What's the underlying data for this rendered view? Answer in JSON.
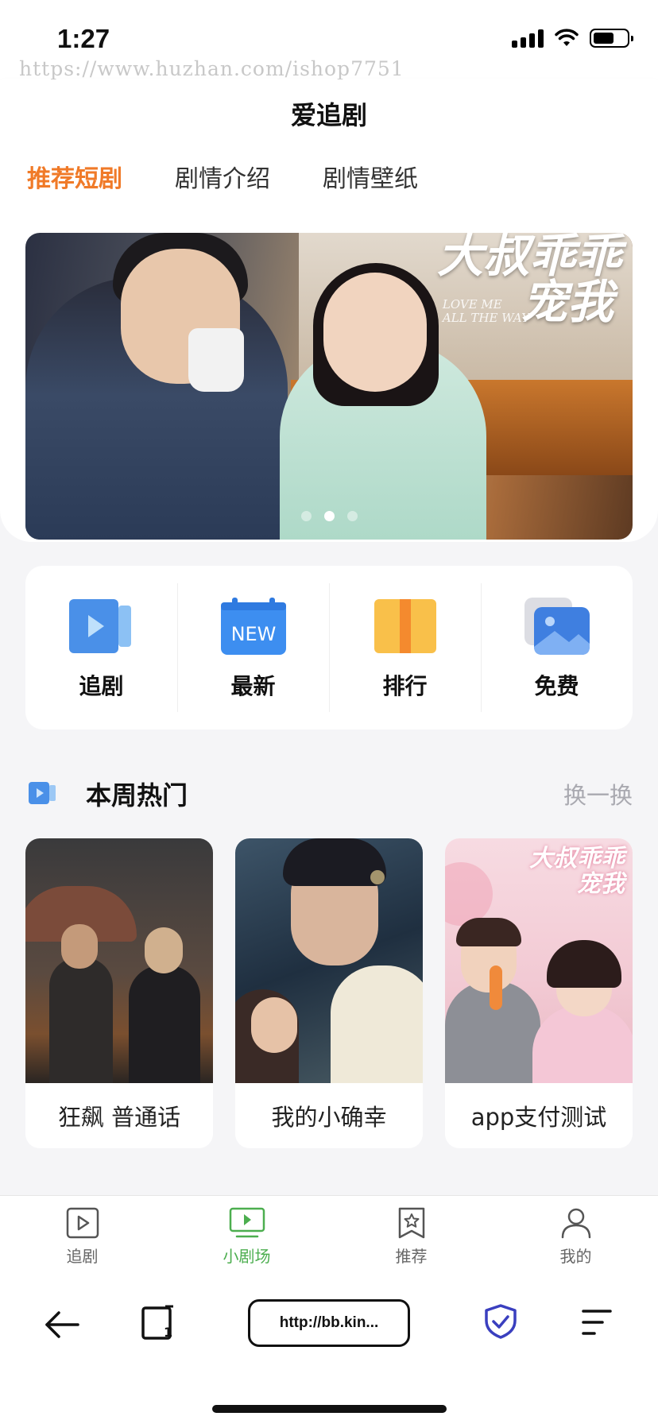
{
  "status_bar": {
    "time": "1:27",
    "watermark": "https://www.huzhan.com/ishop7751"
  },
  "header": {
    "title": "爱追剧",
    "tabs": [
      {
        "label": "推荐短剧",
        "active": true
      },
      {
        "label": "剧情介绍",
        "active": false
      },
      {
        "label": "剧情壁纸",
        "active": false
      }
    ]
  },
  "banner": {
    "title_line1": "大叔乖乖",
    "title_line2": "宠我",
    "subtitle_line1": "LOVE ME",
    "subtitle_line2": "ALL THE WAY",
    "slide_count": 3,
    "active_slide": 2
  },
  "quick_menu": [
    {
      "label": "追剧",
      "icon": "play-video-icon",
      "color": "#4a90e8"
    },
    {
      "label": "最新",
      "icon": "new-calendar-icon",
      "color": "#3d8ef0"
    },
    {
      "label": "排行",
      "icon": "ranking-icon",
      "color": "#f7b73a"
    },
    {
      "label": "免费",
      "icon": "image-icon",
      "color": "#3f7fe0"
    }
  ],
  "hot": {
    "title": "本周热门",
    "refresh_label": "换一换",
    "items": [
      {
        "title": "狂飙 普通话"
      },
      {
        "title": "我的小确幸"
      },
      {
        "title": "app支付测试",
        "poster_text_line1": "大叔乖乖",
        "poster_text_line2": "宠我"
      }
    ]
  },
  "tabbar": [
    {
      "label": "追剧",
      "icon": "play-square-icon",
      "active": false
    },
    {
      "label": "小剧场",
      "icon": "tv-icon",
      "active": true
    },
    {
      "label": "推荐",
      "icon": "star-bookmark-icon",
      "active": false
    },
    {
      "label": "我的",
      "icon": "user-icon",
      "active": false
    }
  ],
  "browser": {
    "url": "http://bb.kin..."
  },
  "colors": {
    "accent": "#f07a28",
    "active_tab_green": "#4cae4f",
    "muted": "#a9a9b0"
  }
}
